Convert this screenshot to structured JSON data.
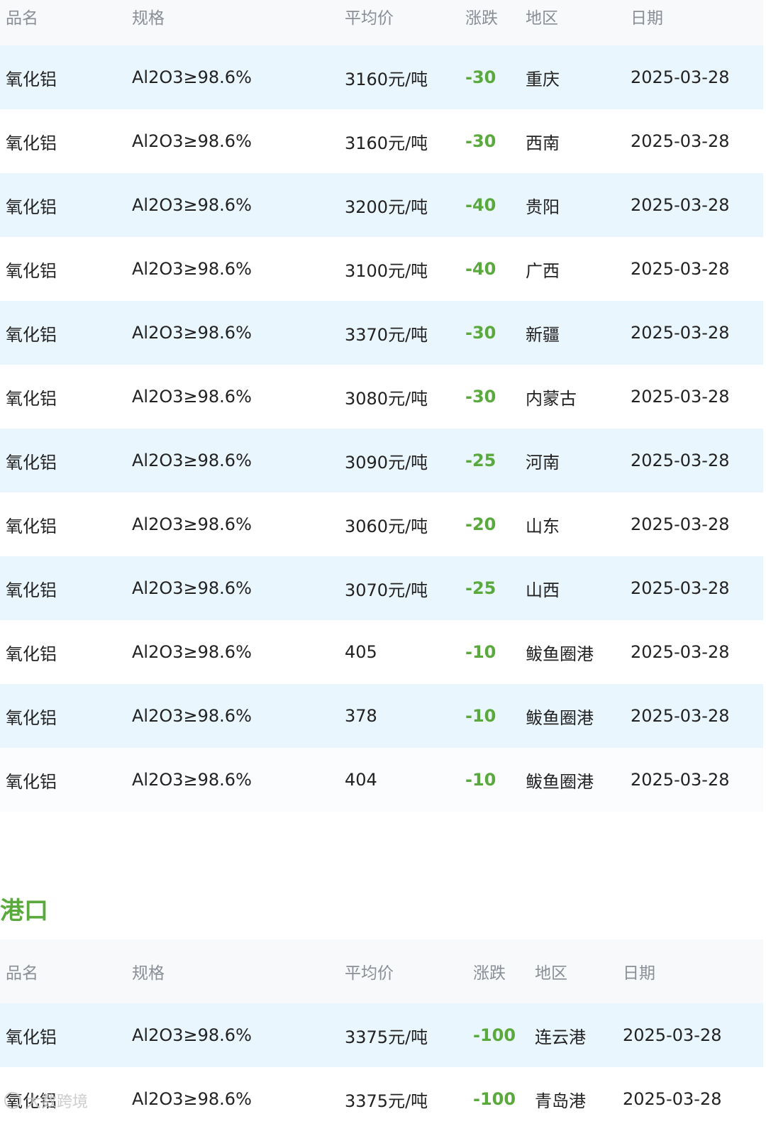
{
  "table1": {
    "headers": [
      "品名",
      "规格",
      "平均价",
      "涨跌",
      "地区",
      "日期"
    ],
    "rows": [
      [
        "氧化铝",
        "Al2O3≥98.6%",
        "3160元/吨",
        "-30",
        "重庆",
        "2025-03-28"
      ],
      [
        "氧化铝",
        "Al2O3≥98.6%",
        "3160元/吨",
        "-30",
        "西南",
        "2025-03-28"
      ],
      [
        "氧化铝",
        "Al2O3≥98.6%",
        "3200元/吨",
        "-40",
        "贵阳",
        "2025-03-28"
      ],
      [
        "氧化铝",
        "Al2O3≥98.6%",
        "3100元/吨",
        "-40",
        "广西",
        "2025-03-28"
      ],
      [
        "氧化铝",
        "Al2O3≥98.6%",
        "3370元/吨",
        "-30",
        "新疆",
        "2025-03-28"
      ],
      [
        "氧化铝",
        "Al2O3≥98.6%",
        "3080元/吨",
        "-30",
        "内蒙古",
        "2025-03-28"
      ],
      [
        "氧化铝",
        "Al2O3≥98.6%",
        "3090元/吨",
        "-25",
        "河南",
        "2025-03-28"
      ],
      [
        "氧化铝",
        "Al2O3≥98.6%",
        "3060元/吨",
        "-20",
        "山东",
        "2025-03-28"
      ],
      [
        "氧化铝",
        "Al2O3≥98.6%",
        "3070元/吨",
        "-25",
        "山西",
        "2025-03-28"
      ],
      [
        "氧化铝",
        "Al2O3≥98.6%",
        "405",
        "-10",
        "鲅鱼圈港",
        "2025-03-28"
      ],
      [
        "氧化铝",
        "Al2O3≥98.6%",
        "378",
        "-10",
        "鲅鱼圈港",
        "2025-03-28"
      ],
      [
        "氧化铝",
        "Al2O3≥98.6%",
        "404",
        "-10",
        "鲅鱼圈港",
        "2025-03-28"
      ]
    ]
  },
  "section2": {
    "title": "港口"
  },
  "table2": {
    "headers": [
      "品名",
      "规格",
      "平均价",
      "涨跌",
      "地区",
      "日期"
    ],
    "rows": [
      [
        "氧化铝",
        "Al2O3≥98.6%",
        "3375元/吨",
        "-100",
        "连云港",
        "2025-03-28"
      ],
      [
        "氧化铝",
        "Al2O3≥98.6%",
        "3375元/吨",
        "-100",
        "青岛港",
        "2025-03-28"
      ]
    ]
  },
  "watermark": "大数跨境",
  "colors": {
    "accent_green": "#5aa93c",
    "row_alt": "#eaf6fd",
    "header_bg": "#f7f9fb"
  }
}
